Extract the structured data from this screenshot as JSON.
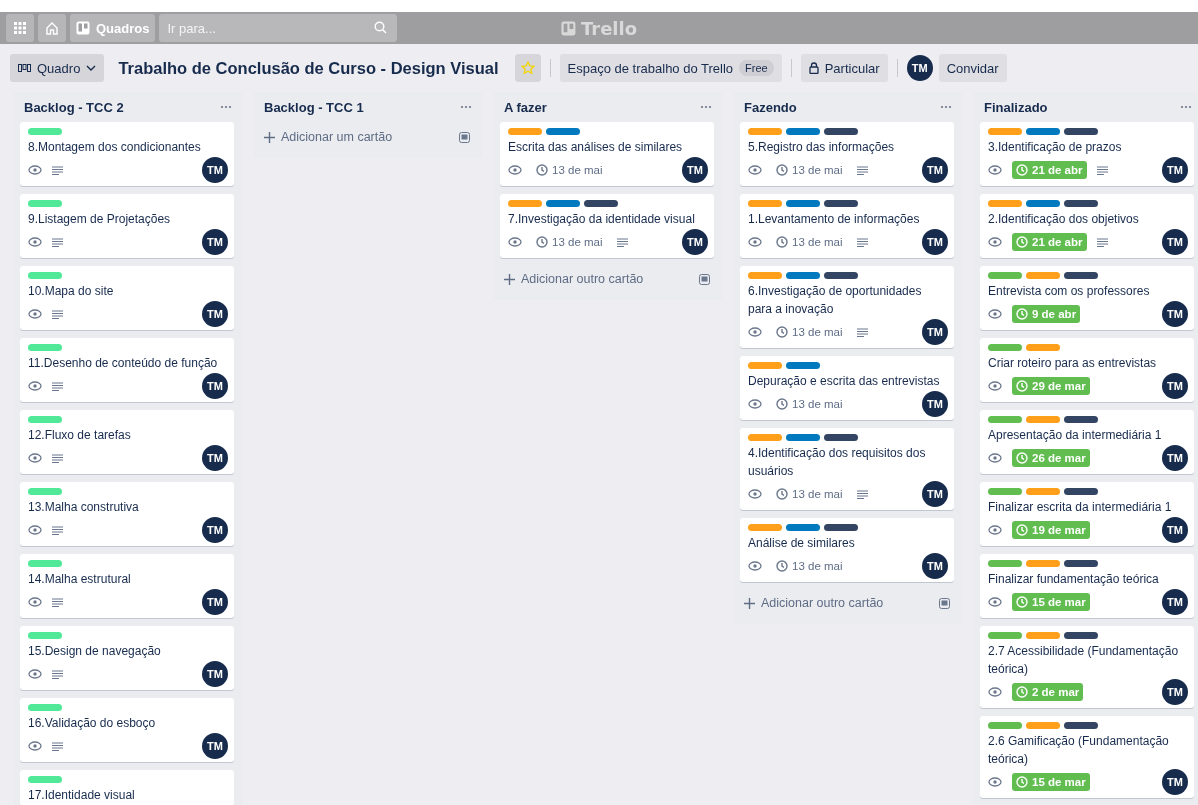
{
  "topbar": {
    "boards_button": "Quadros",
    "search": {
      "placeholder": "Ir para..."
    },
    "logo": "Trello"
  },
  "board_header": {
    "view_button": "Quadro",
    "title": "Trabalho de Conclusão de Curso - Design Visual",
    "starred": true,
    "workspace": {
      "label": "Espaço de trabalho do Trello",
      "badge": "Free"
    },
    "visibility": "Particular",
    "member": "TM",
    "invite": "Convidar"
  },
  "lists": [
    {
      "title": "Backlog - TCC 2",
      "cards": [
        {
          "labels": [
            {
              "color": "#51e898"
            }
          ],
          "title": "8.Montagem dos condicionantes",
          "watch": true,
          "description": true,
          "member": "TM"
        },
        {
          "labels": [
            {
              "color": "#51e898"
            }
          ],
          "title": "9.Listagem de Projetações",
          "watch": true,
          "description": true,
          "member": "TM"
        },
        {
          "labels": [
            {
              "color": "#51e898"
            }
          ],
          "title": "10.Mapa do site",
          "watch": true,
          "description": true,
          "member": "TM"
        },
        {
          "labels": [
            {
              "color": "#51e898"
            }
          ],
          "title": "11.Desenho de conteúdo de função",
          "watch": true,
          "description": true,
          "member": "TM"
        },
        {
          "labels": [
            {
              "color": "#51e898"
            }
          ],
          "title": "12.Fluxo de tarefas",
          "watch": true,
          "description": true,
          "member": "TM"
        },
        {
          "labels": [
            {
              "color": "#51e898"
            }
          ],
          "title": "13.Malha construtiva",
          "watch": true,
          "description": true,
          "member": "TM"
        },
        {
          "labels": [
            {
              "color": "#51e898"
            }
          ],
          "title": "14.Malha estrutural",
          "watch": true,
          "description": true,
          "member": "TM"
        },
        {
          "labels": [
            {
              "color": "#51e898"
            }
          ],
          "title": "15.Design de navegação",
          "watch": true,
          "description": true,
          "member": "TM"
        },
        {
          "labels": [
            {
              "color": "#51e898"
            }
          ],
          "title": "16.Validação do esboço",
          "watch": true,
          "description": true,
          "member": "TM"
        },
        {
          "labels": [
            {
              "color": "#51e898"
            }
          ],
          "title": "17.Identidade visual",
          "watch": false,
          "description": false
        }
      ]
    },
    {
      "title": "Backlog - TCC 1",
      "add_card": "Adicionar um cartão"
    },
    {
      "title": "A fazer",
      "cards": [
        {
          "labels": [
            {
              "color": "#ff9f1a"
            },
            {
              "color": "#0079bf"
            }
          ],
          "title": "Escrita das análises de similares",
          "watch": true,
          "due": {
            "text": "13 de mai",
            "complete": false
          },
          "description": false,
          "member": "TM"
        },
        {
          "labels": [
            {
              "color": "#ff9f1a"
            },
            {
              "color": "#0079bf"
            },
            {
              "color": "#344563"
            }
          ],
          "title": "7.Investigação da identidade visual",
          "watch": true,
          "due": {
            "text": "13 de mai",
            "complete": false
          },
          "description": true,
          "member": "TM"
        }
      ],
      "add_card": "Adicionar outro cartão"
    },
    {
      "title": "Fazendo",
      "cards": [
        {
          "labels": [
            {
              "color": "#ff9f1a"
            },
            {
              "color": "#0079bf"
            },
            {
              "color": "#344563"
            }
          ],
          "title": "5.Registro das informações",
          "watch": true,
          "due": {
            "text": "13 de mai",
            "complete": false
          },
          "description": true,
          "member": "TM"
        },
        {
          "labels": [
            {
              "color": "#ff9f1a"
            },
            {
              "color": "#0079bf"
            },
            {
              "color": "#344563"
            }
          ],
          "title": "1.Levantamento de informações",
          "watch": true,
          "due": {
            "text": "13 de mai",
            "complete": false
          },
          "description": true,
          "member": "TM"
        },
        {
          "labels": [
            {
              "color": "#ff9f1a"
            },
            {
              "color": "#0079bf"
            },
            {
              "color": "#344563"
            }
          ],
          "title": "6.Investigação de oportunidades para a inovação",
          "watch": true,
          "due": {
            "text": "13 de mai",
            "complete": false
          },
          "description": true,
          "member": "TM"
        },
        {
          "labels": [
            {
              "color": "#ff9f1a"
            },
            {
              "color": "#0079bf"
            }
          ],
          "title": "Depuração e escrita das entrevistas",
          "watch": true,
          "due": {
            "text": "13 de mai",
            "complete": false
          },
          "description": false,
          "member": "TM"
        },
        {
          "labels": [
            {
              "color": "#ff9f1a"
            },
            {
              "color": "#0079bf"
            },
            {
              "color": "#344563"
            }
          ],
          "title": "4.Identificação dos requisitos dos usuários",
          "watch": true,
          "due": {
            "text": "13 de mai",
            "complete": false
          },
          "description": true,
          "member": "TM"
        },
        {
          "labels": [
            {
              "color": "#ff9f1a"
            },
            {
              "color": "#0079bf"
            },
            {
              "color": "#344563"
            }
          ],
          "title": "Análise de similares",
          "watch": true,
          "due": {
            "text": "13 de mai",
            "complete": false
          },
          "description": false,
          "member": "TM"
        }
      ],
      "add_card": "Adicionar outro cartão"
    },
    {
      "title": "Finalizado",
      "cards": [
        {
          "labels": [
            {
              "color": "#ff9f1a"
            },
            {
              "color": "#0079bf"
            },
            {
              "color": "#344563"
            }
          ],
          "title": "3.Identificação de prazos",
          "watch": true,
          "due": {
            "text": "21 de abr",
            "complete": true
          },
          "description": true,
          "member": "TM"
        },
        {
          "labels": [
            {
              "color": "#ff9f1a"
            },
            {
              "color": "#0079bf"
            },
            {
              "color": "#344563"
            }
          ],
          "title": "2.Identificação dos objetivos",
          "watch": true,
          "due": {
            "text": "21 de abr",
            "complete": true
          },
          "description": true,
          "member": "TM"
        },
        {
          "labels": [
            {
              "color": "#61bd4f"
            },
            {
              "color": "#ff9f1a"
            },
            {
              "color": "#344563"
            }
          ],
          "title": "Entrevista com os professores",
          "watch": true,
          "due": {
            "text": "9 de abr",
            "complete": true
          },
          "description": false,
          "member": "TM"
        },
        {
          "labels": [
            {
              "color": "#61bd4f"
            },
            {
              "color": "#ff9f1a"
            }
          ],
          "title": "Criar roteiro para as entrevistas",
          "watch": true,
          "due": {
            "text": "29 de mar",
            "complete": true
          },
          "description": false,
          "member": "TM"
        },
        {
          "labels": [
            {
              "color": "#61bd4f"
            },
            {
              "color": "#ff9f1a"
            },
            {
              "color": "#344563"
            }
          ],
          "title": "Apresentação da intermediária 1",
          "watch": true,
          "due": {
            "text": "26 de mar",
            "complete": true
          },
          "description": false,
          "member": "TM"
        },
        {
          "labels": [
            {
              "color": "#61bd4f"
            },
            {
              "color": "#ff9f1a"
            },
            {
              "color": "#344563"
            }
          ],
          "title": "Finalizar escrita da intermediária 1",
          "watch": true,
          "due": {
            "text": "19 de mar",
            "complete": true
          },
          "description": false,
          "member": "TM"
        },
        {
          "labels": [
            {
              "color": "#61bd4f"
            },
            {
              "color": "#ff9f1a"
            },
            {
              "color": "#344563"
            }
          ],
          "title": "Finalizar fundamentação teórica",
          "watch": true,
          "due": {
            "text": "15 de mar",
            "complete": true
          },
          "description": false,
          "member": "TM"
        },
        {
          "labels": [
            {
              "color": "#61bd4f"
            },
            {
              "color": "#ff9f1a"
            },
            {
              "color": "#344563"
            }
          ],
          "title": "2.7 Acessibilidade (Fundamentação teórica)",
          "watch": true,
          "due": {
            "text": "2 de mar",
            "complete": true
          },
          "description": false,
          "member": "TM"
        },
        {
          "labels": [
            {
              "color": "#61bd4f"
            },
            {
              "color": "#ff9f1a"
            },
            {
              "color": "#344563"
            }
          ],
          "title": "2.6 Gamificação (Fundamentação teórica)",
          "watch": true,
          "due": {
            "text": "15 de mar",
            "complete": true
          },
          "description": false,
          "member": "TM"
        }
      ]
    }
  ]
}
